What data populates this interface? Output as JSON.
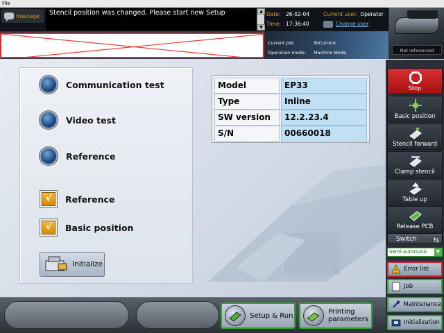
{
  "menubar": {
    "file": "File"
  },
  "header": {
    "message_label": "message",
    "message_text": "Stencil position was changed. Please start new Setup",
    "date_label": "Date:",
    "date_value": "26-02-04",
    "time_label": "Time:",
    "time_value": "17:36:40",
    "current_user_label": "Current user:",
    "current_user_value": "Operator",
    "change_user_label": "Change user",
    "reference_status": "Not referenced"
  },
  "job": {
    "current_job_label": "Current job:",
    "current_job_value": "lblCurrent",
    "operation_mode_label": "Operation mode:",
    "operation_mode_value": "Machine Mode"
  },
  "tests": [
    {
      "label": "Communication test"
    },
    {
      "label": "Video test"
    },
    {
      "label": "Reference"
    }
  ],
  "checks": [
    {
      "label": "Reference",
      "mark": "√"
    },
    {
      "label": "Basic position",
      "mark": "√"
    }
  ],
  "initialize_label": "Initialize",
  "info": [
    {
      "key": "Model",
      "value": "EP33"
    },
    {
      "key": "Type",
      "value": "Inline"
    },
    {
      "key": "SW version",
      "value": "12.2.23.4"
    },
    {
      "key": "S/N",
      "value": "00660018"
    }
  ],
  "toolbar": {
    "stop": "Stop",
    "basic_position": "Basic position",
    "stencil_forward": "Stencil forward",
    "clamp_stencil": "Clamp stencil",
    "table_up": "Table up",
    "release_pcb": "Release PCB",
    "switch": "Switch",
    "mode": "Semi-automatic",
    "error_list": "Error list",
    "job": "Job",
    "maintenance": "Maintenance",
    "initialization": "Initialization"
  },
  "bottom": {
    "setup_run": "Setup & Run",
    "printing_params_1": "Printing",
    "printing_params_2": "parameters"
  },
  "colors": {
    "accent_orange": "#d8a000",
    "stop_red": "#c82020",
    "active_green": "#2fa52f",
    "value_blue": "#bfe0f5"
  }
}
